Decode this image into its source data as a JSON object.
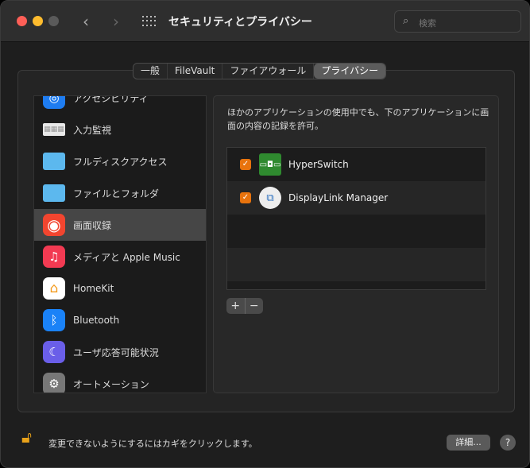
{
  "window": {
    "title": "セキュリティとプライバシー",
    "search_placeholder": "検索",
    "colors": {
      "close": "#fe5f57",
      "minimize": "#febc2e",
      "accent": "#e8730d"
    }
  },
  "tabs": [
    {
      "label": "一般"
    },
    {
      "label": "FileVault"
    },
    {
      "label": "ファイアウォール"
    },
    {
      "label": "プライバシー",
      "selected": true
    }
  ],
  "sidebar": {
    "items": [
      {
        "label": "アクセシビリティ",
        "icon": "accessibility-icon"
      },
      {
        "label": "入力監視",
        "icon": "keyboard-icon"
      },
      {
        "label": "フルディスクアクセス",
        "icon": "folder-icon"
      },
      {
        "label": "ファイルとフォルダ",
        "icon": "folder-icon"
      },
      {
        "label": "画面収録",
        "icon": "screen-record-icon",
        "selected": true
      },
      {
        "label": "メディアと Apple Music",
        "icon": "music-icon"
      },
      {
        "label": "HomeKit",
        "icon": "home-icon"
      },
      {
        "label": "Bluetooth",
        "icon": "bluetooth-icon"
      },
      {
        "label": "ユーザ応答可能状況",
        "icon": "moon-icon"
      },
      {
        "label": "オートメーション",
        "icon": "gear-icon"
      }
    ]
  },
  "main": {
    "description": "ほかのアプリケーションの使用中でも、下のアプリケーションに画面の内容の記録を許可。",
    "apps": [
      {
        "name": "HyperSwitch",
        "checked": true
      },
      {
        "name": "DisplayLink Manager",
        "checked": true
      }
    ],
    "add_label": "+",
    "remove_label": "−"
  },
  "footer": {
    "lock_text": "変更できないようにするにはカギをクリックします。",
    "advanced_label": "詳細...",
    "help_label": "?"
  }
}
